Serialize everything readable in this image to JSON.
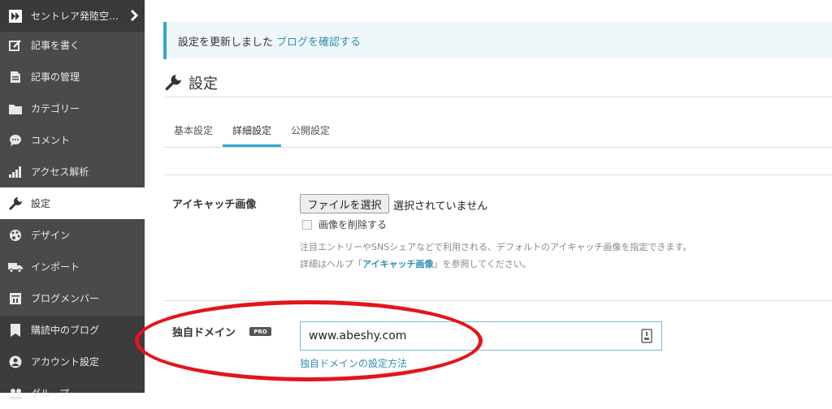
{
  "sidebar": {
    "blog_name": "セントレア発陸空…",
    "items": [
      {
        "label": "記事を書く",
        "icon": "edit-icon"
      },
      {
        "label": "記事の管理",
        "icon": "document-icon"
      },
      {
        "label": "カテゴリー",
        "icon": "folder-icon"
      },
      {
        "label": "コメント",
        "icon": "comment-icon"
      },
      {
        "label": "アクセス解析",
        "icon": "bar-chart-icon"
      },
      {
        "label": "設定",
        "icon": "wrench-icon",
        "active": true
      },
      {
        "label": "デザイン",
        "icon": "palette-icon"
      },
      {
        "label": "インポート",
        "icon": "truck-icon"
      },
      {
        "label": "ブログメンバー",
        "icon": "members-icon"
      },
      {
        "label": "購読中のブログ",
        "icon": "bookmark-icon"
      },
      {
        "label": "アカウント設定",
        "icon": "account-icon"
      },
      {
        "label": "グループ",
        "icon": "group-icon"
      }
    ]
  },
  "notice": {
    "text": "設定を更新しました",
    "link": "ブログを確認する"
  },
  "page": {
    "title": "設定"
  },
  "tabs": [
    {
      "label": "基本設定",
      "active": false
    },
    {
      "label": "詳細設定",
      "active": true
    },
    {
      "label": "公開設定",
      "active": false
    }
  ],
  "eyecatch": {
    "label": "アイキャッチ画像",
    "file_button": "ファイルを選択",
    "file_status": "選択されていません",
    "delete_checkbox": "画像を削除する",
    "desc_line1": "注目エントリーやSNSシェアなどで利用される、デフォルトのアイキャッチ画像を指定できます。",
    "desc_line2_prefix": "詳細はヘルプ「",
    "desc_line2_link": "アイキャッチ画像",
    "desc_line2_suffix": "」を参照してください。"
  },
  "domain": {
    "label": "独自ドメイン",
    "badge": "PRO",
    "value": "www.abeshy.com",
    "help_link": "独自ドメインの設定方法"
  },
  "colors": {
    "sidebar_bg": "#4a4a4a",
    "accent": "#35a7c9",
    "link": "#2f8fb4",
    "annotation": "#e3151c"
  }
}
